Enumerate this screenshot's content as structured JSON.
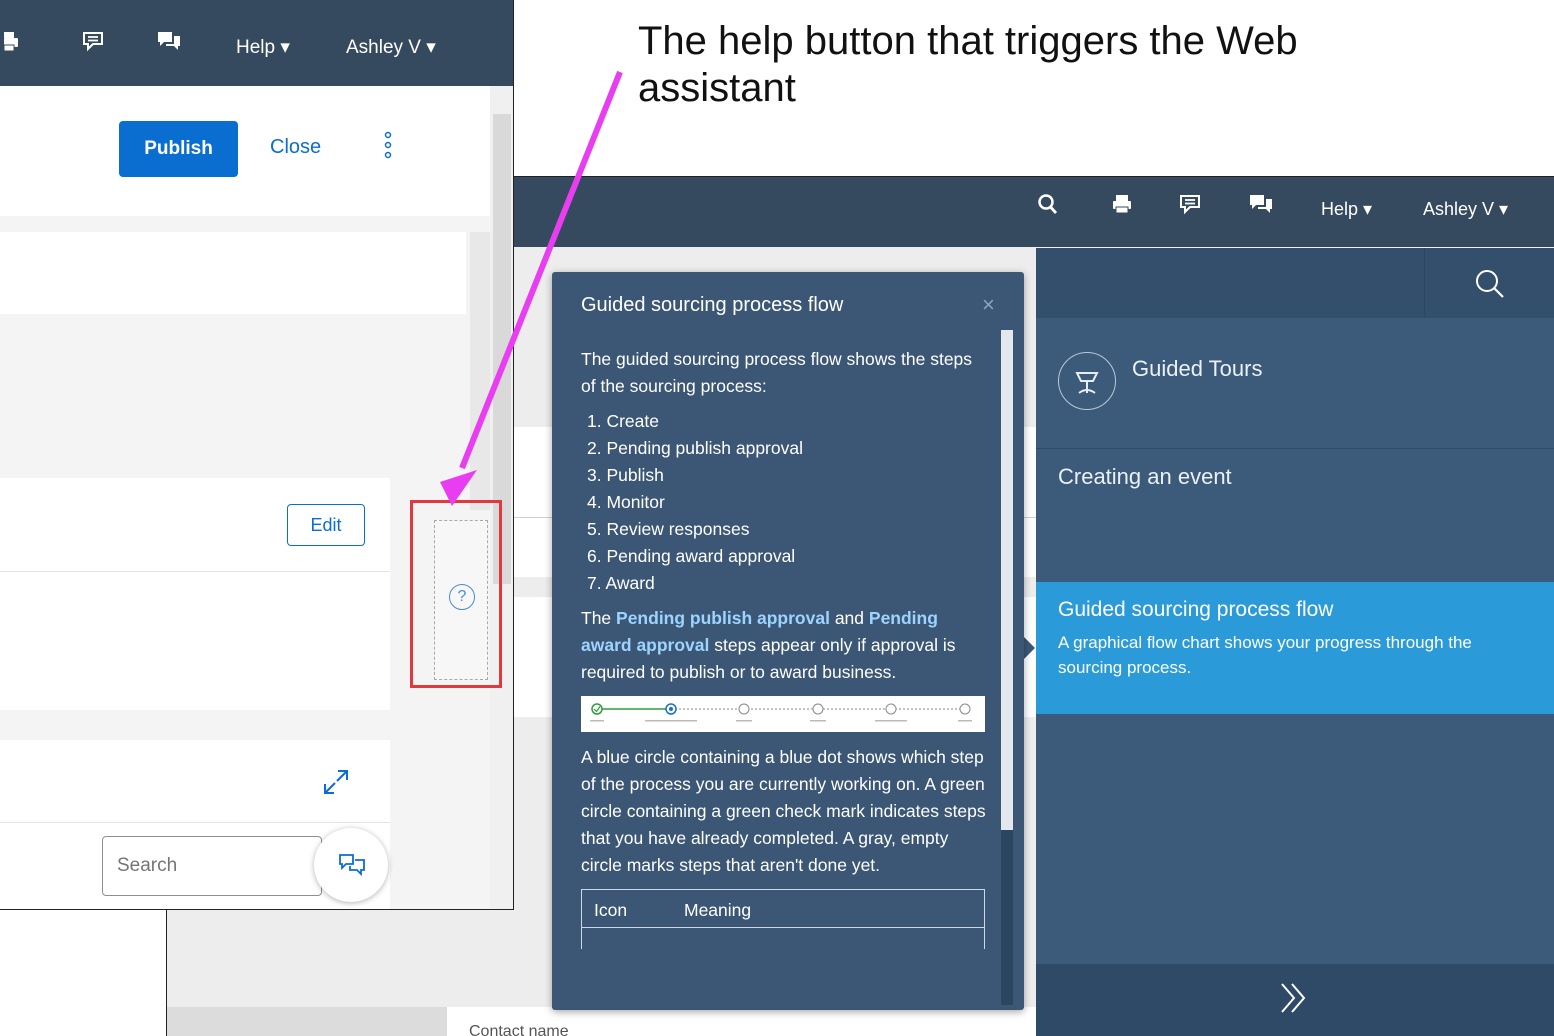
{
  "caption": {
    "text": "The help button that triggers the Web assistant"
  },
  "back_header": {
    "help_label": "Help ▾",
    "user_label": "Ashley V ▾"
  },
  "back_content": {
    "contact_name": "Contact name"
  },
  "help_panel": {
    "guided_tours_label": "Guided Tours",
    "creating_event_label": "Creating an event",
    "selected_topic": {
      "title": "Guided sourcing process flow",
      "description": "A graphical flow chart shows your progress through the sourcing process."
    },
    "accent_color": "#2a9ad8"
  },
  "help_card": {
    "title": "Guided sourcing process flow",
    "close_glyph": "×",
    "intro": "The guided sourcing process flow shows the steps of the sourcing process:",
    "steps": [
      "1. Create",
      "2. Pending publish approval",
      "3. Publish",
      "4. Monitor",
      "5. Review responses",
      "6. Pending award approval",
      "7. Award"
    ],
    "approval_text_1": "The",
    "approval_highlight_1": "Pending publish approval",
    "approval_text_2": "and",
    "approval_highlight_2": "Pending award approval",
    "approval_text_3": "steps appear only if approval is required to publish or to award business.",
    "legend_text": "A blue circle containing a blue dot shows which step of the process you are currently working on. A green circle containing a green check mark indicates steps that you have already completed. A gray, empty circle marks steps that aren't done yet.",
    "table_headers": [
      "Icon",
      "Meaning"
    ]
  },
  "front_header": {
    "help_label": "Help ▾",
    "user_label": "Ashley V ▾"
  },
  "front_toolbar": {
    "publish_label": "Publish",
    "close_label": "Close"
  },
  "front_content": {
    "edit_label": "Edit",
    "search_placeholder": "Search",
    "help_glyph": "?"
  },
  "colors": {
    "header_bg": "#354a5f",
    "primary_blue": "#0a6ed1",
    "arrow": "#e83df0",
    "highlight_box": "#e0393e"
  },
  "icons": {
    "back_header": [
      "search-icon",
      "print-icon",
      "feedback-icon",
      "chat-icon"
    ],
    "front_header": [
      "print-icon",
      "feedback-icon",
      "chat-icon"
    ],
    "help_panel": [
      "search-icon",
      "guided-tours-icon",
      "double-chevron-right-icon"
    ],
    "front_content": [
      "expand-icon",
      "chat-bubble-icon",
      "help-icon",
      "more-icon"
    ]
  }
}
